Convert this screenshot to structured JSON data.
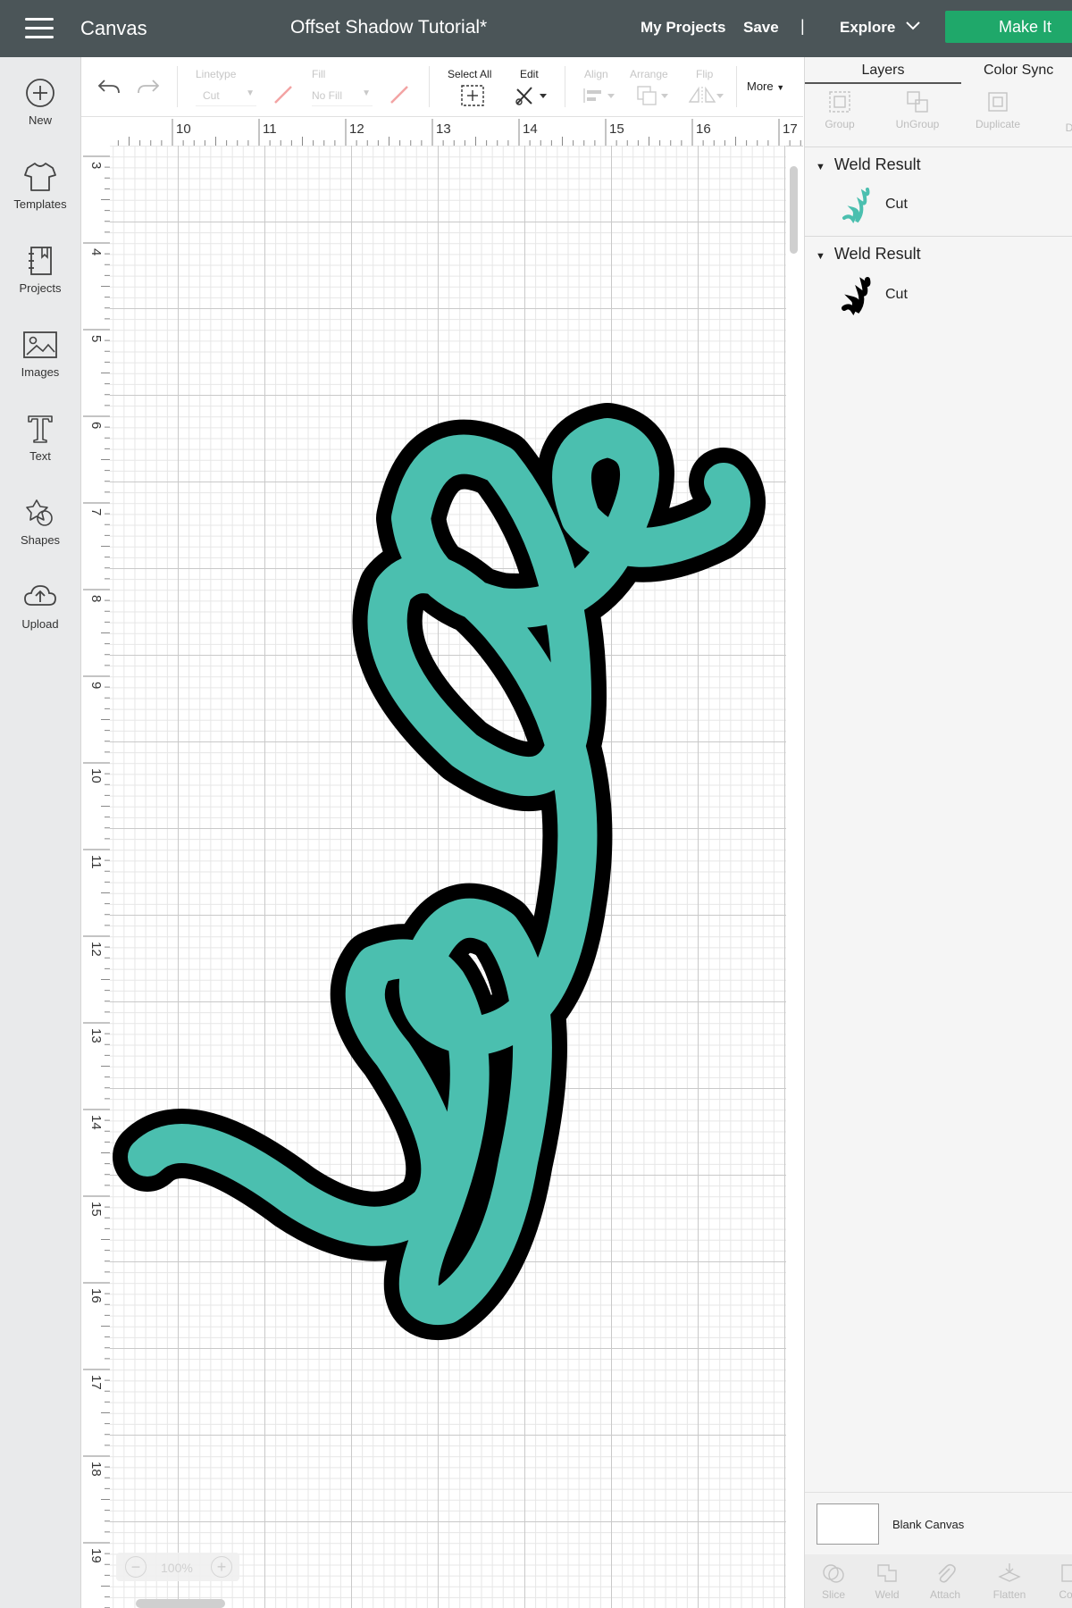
{
  "app": {
    "title": "Canvas",
    "project_title": "Offset Shadow Tutorial*"
  },
  "nav": {
    "my_projects": "My Projects",
    "save": "Save",
    "separator": "|",
    "explore": "Explore",
    "make_it": "Make It"
  },
  "sidebar": {
    "items": [
      {
        "label": "New",
        "icon": "plus-circle-icon"
      },
      {
        "label": "Templates",
        "icon": "tshirt-icon"
      },
      {
        "label": "Projects",
        "icon": "notebook-icon"
      },
      {
        "label": "Images",
        "icon": "image-icon"
      },
      {
        "label": "Text",
        "icon": "text-icon"
      },
      {
        "label": "Shapes",
        "icon": "shapes-icon"
      },
      {
        "label": "Upload",
        "icon": "cloud-upload-icon"
      }
    ]
  },
  "toolbar": {
    "linetype_label": "Linetype",
    "linetype_value": "Cut",
    "fill_label": "Fill",
    "fill_value": "No Fill",
    "select_all": "Select All",
    "edit": "Edit",
    "align": "Align",
    "arrange": "Arrange",
    "flip": "Flip",
    "more": "More"
  },
  "ruler": {
    "top": [
      "10",
      "11",
      "12",
      "13",
      "14",
      "15",
      "16",
      "17"
    ],
    "left": [
      "3",
      "4",
      "5",
      "6",
      "7",
      "8",
      "9",
      "10",
      "11",
      "12",
      "13",
      "14",
      "15",
      "16",
      "17",
      "18",
      "19"
    ]
  },
  "canvas": {
    "zoom": "100%",
    "fill_color": "#4bbfaf",
    "shadow_color": "#000000"
  },
  "panel": {
    "tabs": [
      "Layers",
      "Color Sync"
    ],
    "buttons": [
      "Group",
      "UnGroup",
      "Duplicate",
      "D"
    ],
    "groups": [
      {
        "name": "Weld Result",
        "layer": "Cut"
      },
      {
        "name": "Weld Result",
        "layer": "Cut"
      }
    ],
    "blank_canvas": "Blank Canvas",
    "bottom_tools": [
      "Slice",
      "Weld",
      "Attach",
      "Flatten",
      "Co"
    ]
  }
}
